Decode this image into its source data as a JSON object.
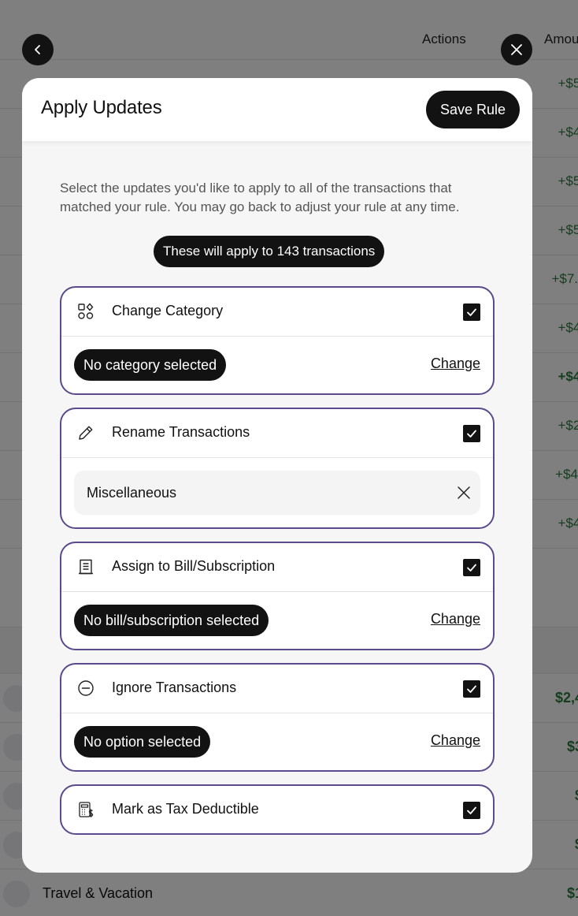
{
  "background": {
    "columns": {
      "actions": "Actions",
      "amount": "Amou"
    },
    "amounts": [
      "+$5.",
      "+$4.",
      "+$5.",
      "+$5.",
      "+$7.",
      "+$4.",
      "+$4.",
      "+$2.",
      "+$4",
      "+$4."
    ],
    "category_amounts": [
      "$2,4",
      "$3",
      "$",
      "$",
      "$1"
    ],
    "last_category": "Travel & Vacation"
  },
  "modal": {
    "title": "Apply Updates",
    "save_label": "Save Rule",
    "intro": "Select the updates you'd like to apply to all of the transactions that matched your rule. You may go back to adjust your rule at any time.",
    "count_label": "These will apply to 143 transactions",
    "change_label": "Change",
    "sections": {
      "category": {
        "label": "Change Category",
        "checked": true,
        "icon": "shapes-icon",
        "value": "No category selected"
      },
      "rename": {
        "label": "Rename Transactions",
        "checked": true,
        "icon": "pencil-icon",
        "input_value": "Miscellaneous"
      },
      "bill": {
        "label": "Assign to Bill/Subscription",
        "checked": true,
        "icon": "receipt-icon",
        "value": "No bill/subscription selected"
      },
      "ignore": {
        "label": "Ignore Transactions",
        "checked": true,
        "icon": "minus-circle-icon",
        "value": "No option selected"
      },
      "tax": {
        "label": "Mark as Tax Deductible",
        "checked": true,
        "icon": "calculator-icon"
      }
    }
  },
  "colors": {
    "card_border": "#5b4a8c",
    "dark": "#121212",
    "positive": "#2a7a3c"
  }
}
